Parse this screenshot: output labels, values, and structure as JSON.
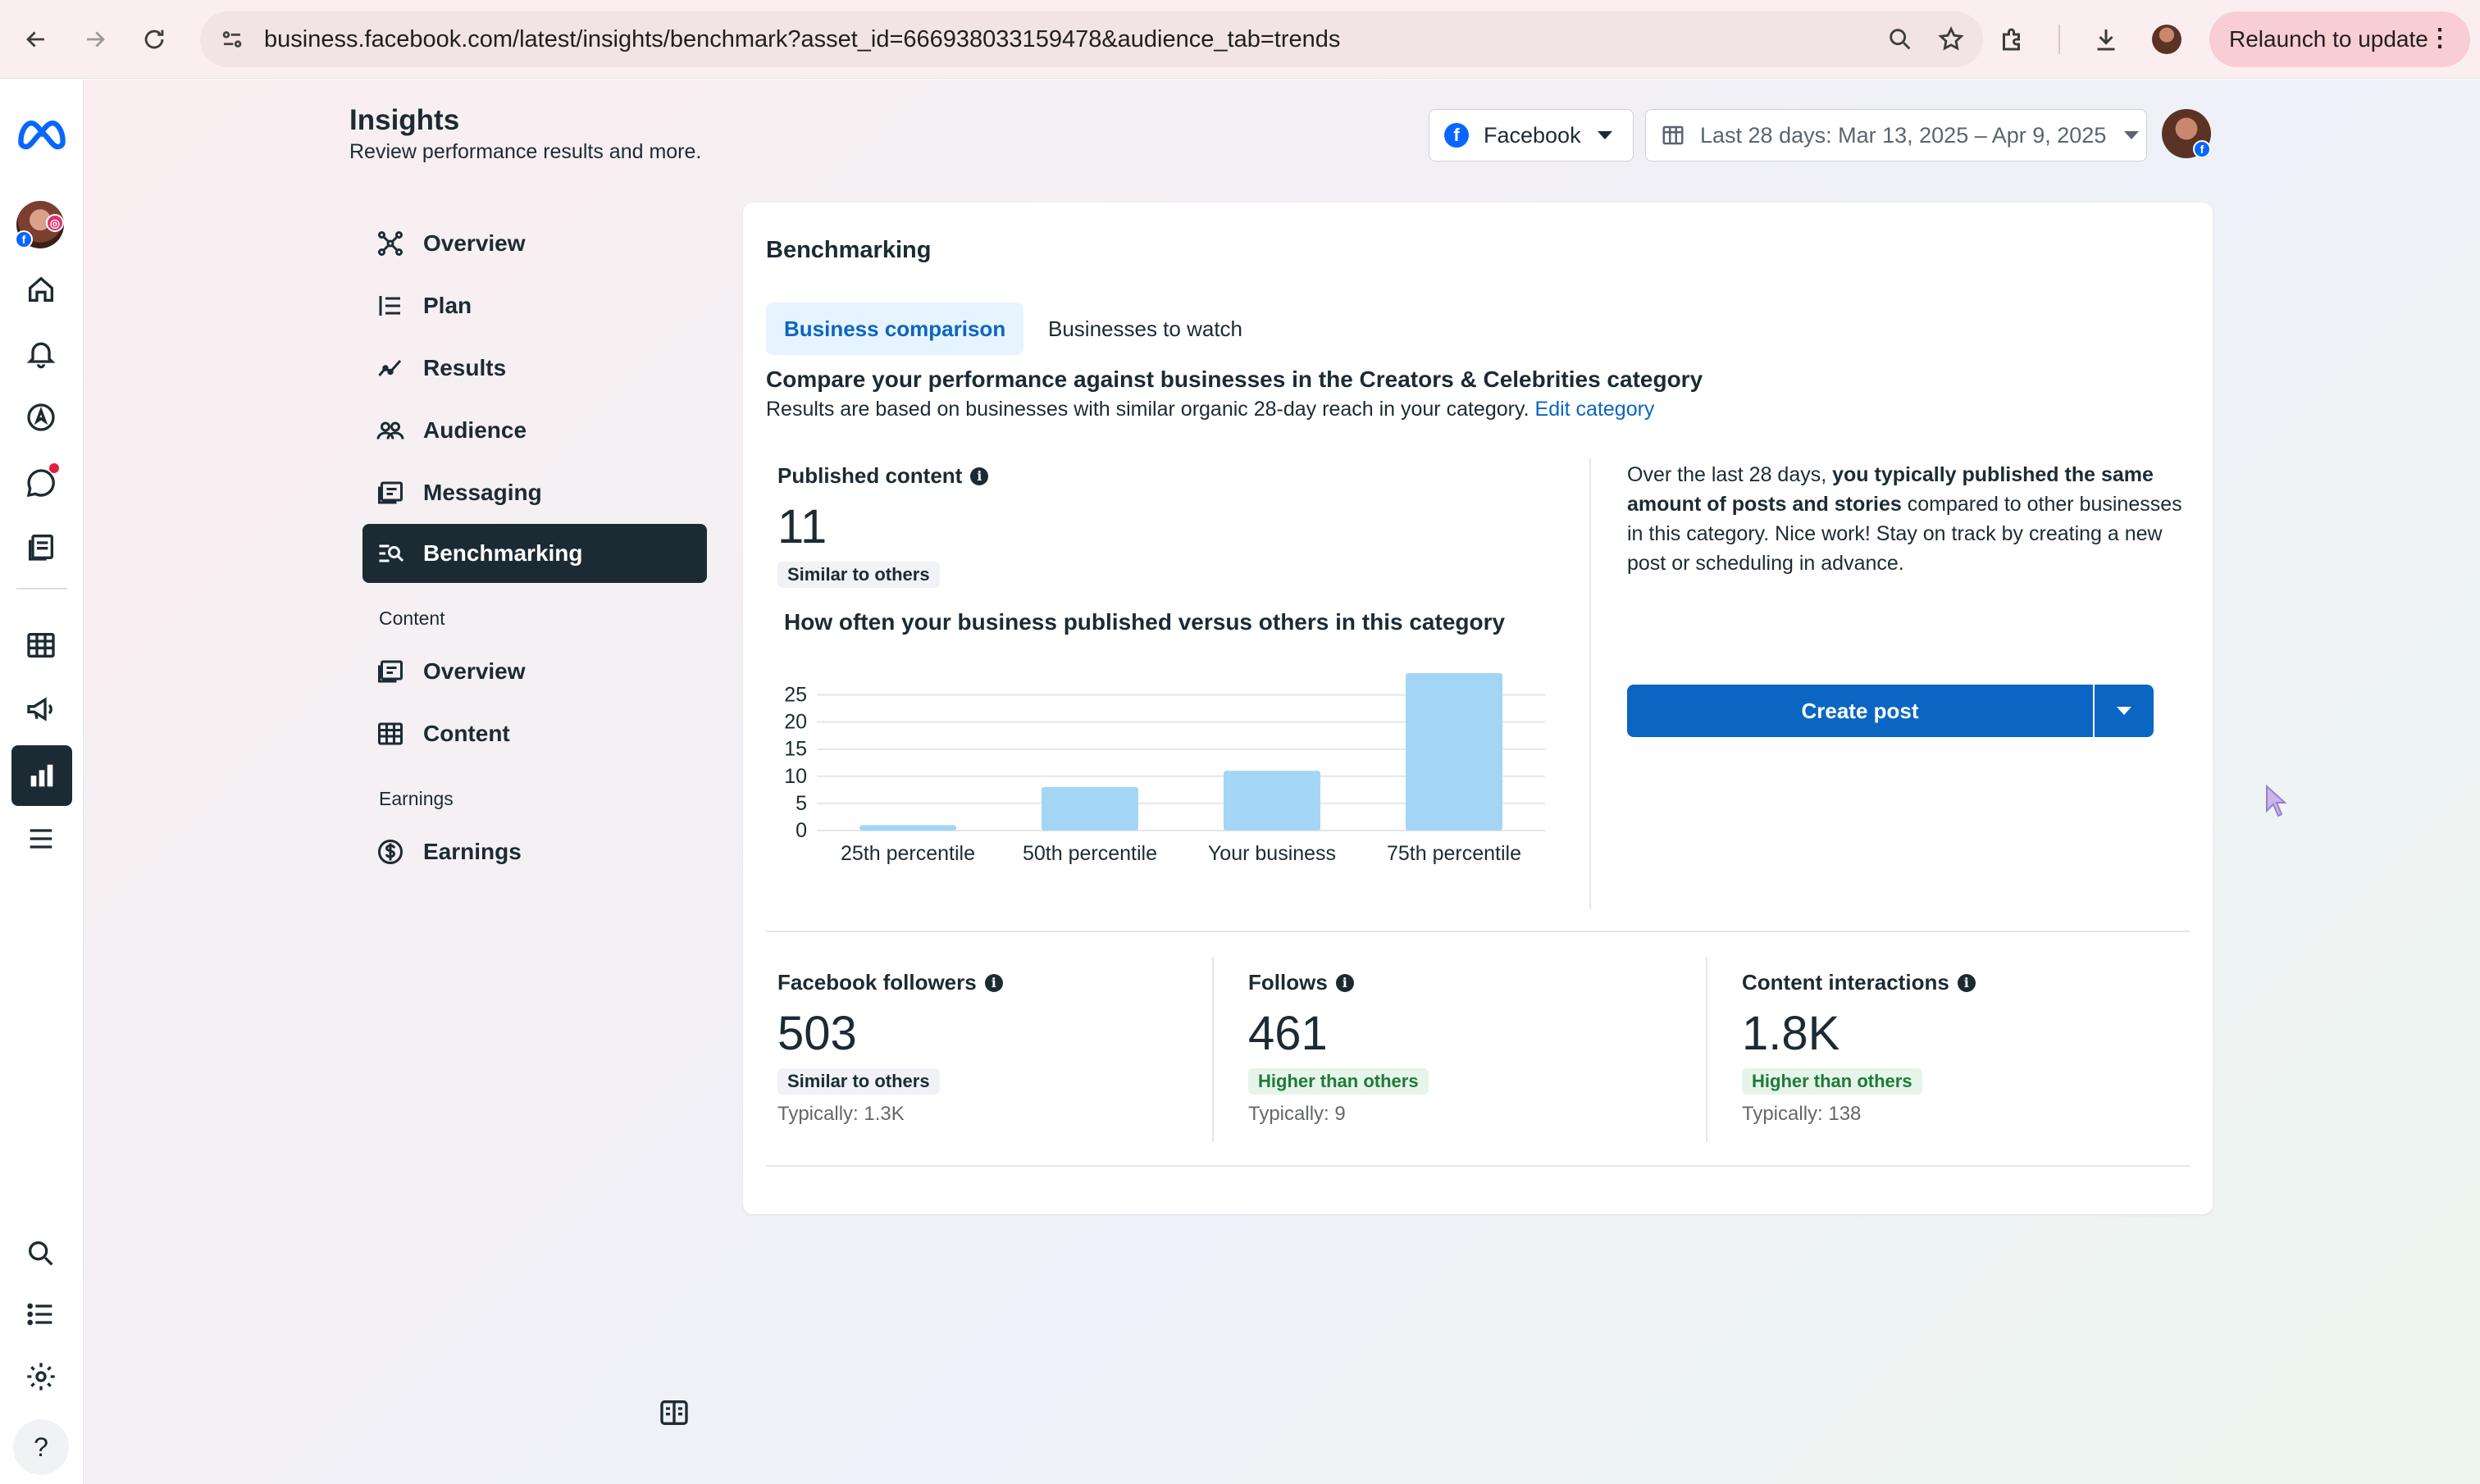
{
  "browser": {
    "url": "business.facebook.com/latest/insights/benchmark?asset_id=666938033159478&audience_tab=trends",
    "relaunch_label": "Relaunch to update"
  },
  "header": {
    "title": "Insights",
    "subtitle": "Review performance results and more.",
    "platform_select": "Facebook",
    "date_range": "Last 28 days: Mar 13, 2025 – Apr 9, 2025"
  },
  "sidebar": {
    "items": [
      {
        "label": "Overview",
        "icon": "network-icon"
      },
      {
        "label": "Plan",
        "icon": "list-icon"
      },
      {
        "label": "Results",
        "icon": "trend-icon"
      },
      {
        "label": "Audience",
        "icon": "people-icon"
      },
      {
        "label": "Messaging",
        "icon": "messaging-icon"
      },
      {
        "label": "Benchmarking",
        "icon": "benchmark-icon",
        "active": true
      }
    ],
    "content_section": "Content",
    "content_items": [
      {
        "label": "Overview",
        "icon": "content-overview-icon"
      },
      {
        "label": "Content",
        "icon": "table-icon"
      }
    ],
    "earnings_section": "Earnings",
    "earnings_items": [
      {
        "label": "Earnings",
        "icon": "dollar-icon"
      }
    ]
  },
  "card": {
    "title": "Benchmarking",
    "tabs": [
      "Business comparison",
      "Businesses to watch"
    ],
    "compare_heading": "Compare your performance against businesses in the Creators & Celebrities category",
    "compare_sub": "Results are based on businesses with similar organic 28-day reach in your category.",
    "edit_category": "Edit category",
    "published": {
      "title": "Published content",
      "value": "11",
      "status": "Similar to others"
    },
    "chart_title": "How often your business published versus others in this category",
    "advice_pre": "Over the last 28 days, ",
    "advice_bold": "you typically published the same amount of posts and stories",
    "advice_post": " compared to other businesses in this category. Nice work! Stay on track by creating a new post or scheduling in advance.",
    "create_post": "Create post",
    "metrics": [
      {
        "title": "Facebook followers",
        "value": "503",
        "status": "Similar to others",
        "status_type": "neutral",
        "typically": "Typically: 1.3K"
      },
      {
        "title": "Follows",
        "value": "461",
        "status": "Higher than others",
        "status_type": "good",
        "typically": "Typically: 9"
      },
      {
        "title": "Content interactions",
        "value": "1.8K",
        "status": "Higher than others",
        "status_type": "good",
        "typically": "Typically: 138"
      }
    ]
  },
  "chart_data": {
    "type": "bar",
    "categories": [
      "25th percentile",
      "50th percentile",
      "Your business",
      "75th percentile"
    ],
    "values": [
      1,
      8,
      11,
      29
    ],
    "yticks": [
      0,
      5,
      10,
      15,
      20,
      25
    ],
    "ylim": [
      0,
      29
    ],
    "grid": true,
    "bar_color": "#a3d6f5"
  },
  "colors": {
    "accent": "#0a66c2",
    "sidebar_active": "#1c2b33",
    "good": "#1e7a3a"
  }
}
